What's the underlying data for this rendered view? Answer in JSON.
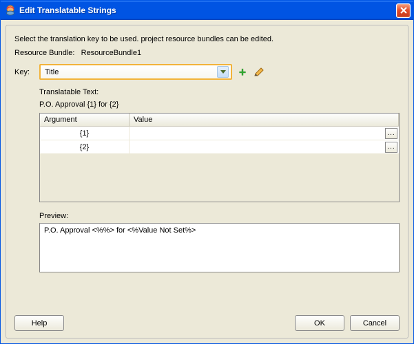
{
  "window": {
    "title": "Edit Translatable Strings"
  },
  "instruction": "Select the translation key to be used. project resource bundles can be edited.",
  "bundle": {
    "label": "Resource Bundle:",
    "value": "ResourceBundle1"
  },
  "key": {
    "label": "Key:",
    "selected": "Title"
  },
  "section": {
    "translatable_label": "Translatable Text:",
    "translatable_value": "P.O. Approval {1} for {2}",
    "columns": {
      "argument": "Argument",
      "value": "Value"
    },
    "rows": [
      {
        "argument": "{1}",
        "value": ""
      },
      {
        "argument": "{2}",
        "value": ""
      }
    ],
    "row_button": "..."
  },
  "preview": {
    "label": "Preview:",
    "text": "P.O. Approval <%%> for <%Value Not Set%>"
  },
  "buttons": {
    "help": "Help",
    "ok": "OK",
    "cancel": "Cancel"
  }
}
